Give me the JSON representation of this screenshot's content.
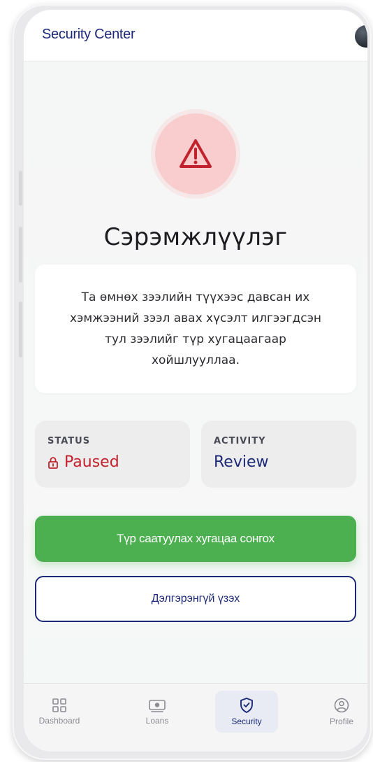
{
  "header": {
    "title": "Security Center"
  },
  "alert": {
    "title": "Сэрэмжлүүлэг",
    "message": "Та өмнөх зээлийн түүхээс давсан их хэмжээний зээл авах хүсэлт илгээгдсэн тул зээлийг түр хугацаагаар хойшлууллаа."
  },
  "status": {
    "label": "STATUS",
    "value": "Paused"
  },
  "activity": {
    "label": "ACTIVITY",
    "value": "Review"
  },
  "actions": {
    "primary": "Түр саатуулах хугацаа сонгох",
    "secondary": "Дэлгэрэнгүй үзэх"
  },
  "nav": [
    {
      "label": "Dashboard",
      "icon": "dashboard-icon"
    },
    {
      "label": "Loans",
      "icon": "loans-icon"
    },
    {
      "label": "Security",
      "icon": "security-icon",
      "active": true
    },
    {
      "label": "Profile",
      "icon": "profile-icon"
    }
  ],
  "colors": {
    "brand": "#1d2a78",
    "danger": "#c1222d",
    "success": "#4caf50",
    "warning_bg": "#f9cdcd"
  }
}
